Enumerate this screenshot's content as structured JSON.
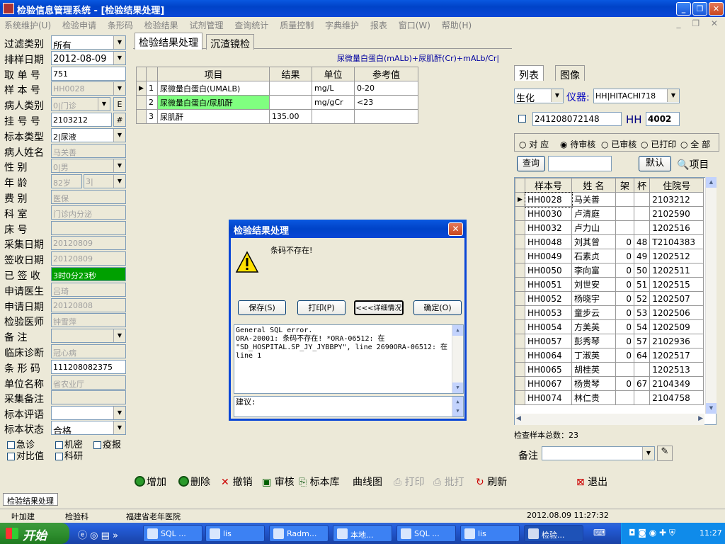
{
  "window": {
    "title": "检验信息管理系统 - [检验结果处理]"
  },
  "menu": [
    "系统维护(U)",
    "检验申请",
    "条形码",
    "检验结果",
    "试剂管理",
    "查询统计",
    "质量控制",
    "字典维护",
    "报表",
    "窗口(W)",
    "帮助(H)"
  ],
  "left": {
    "filter_label": "过滤类别",
    "filter_value": "所有",
    "sort_date_label": "排样日期",
    "sort_date_value": "2012-08-09",
    "order_no_label": "取 单 号",
    "order_no_value": "751",
    "sample_no_label": "样 本 号",
    "sample_no_value": "HH0028",
    "patient_type_label": "病人类别",
    "patient_type_value": "0|门诊",
    "patient_type_btn": "E",
    "reg_no_label": "挂 号 号",
    "reg_no_value": "2103212",
    "reg_no_btn": "#",
    "specimen_label": "标本类型",
    "specimen_value": "2|尿液",
    "name_label": "病人姓名",
    "name_value": "马关善",
    "sex_label": "性    别",
    "sex_value": "0|男",
    "age_label": "年    龄",
    "age_value": "82岁",
    "age_unit": "3|",
    "fee_label": "费    别",
    "fee_value": "医保",
    "dept_label": "科    室",
    "dept_value": "门诊内分泌",
    "bed_label": "床    号",
    "bed_value": "",
    "collect_date_label": "采集日期",
    "collect_date_value": "20120809",
    "receive_date_label": "签收日期",
    "receive_date_value": "20120809",
    "signed_label": "已 签 收",
    "signed_value": "3时0分23秒",
    "req_doctor_label": "申请医生",
    "req_doctor_value": "吕琦",
    "req_date_label": "申请日期",
    "req_date_value": "20120808",
    "lab_doctor_label": "检验医师",
    "lab_doctor_value": "钟雪萍",
    "note_label": "备    注",
    "note_value": "",
    "diag_label": "临床诊断",
    "diag_value": "冠心病",
    "barcode_label": "条 形 码",
    "barcode_value": "111208082375",
    "unit_label": "单位名称",
    "unit_value": "省农业厅",
    "collect_note_label": "采集备注",
    "collect_note_value": "",
    "eval_label": "标本评语",
    "eval_value": "",
    "status_label": "标本状态",
    "status_value": "合格",
    "cb_urgent": "急诊",
    "cb_secret": "机密",
    "cb_epidemic": "疫报",
    "cb_compare": "对比值",
    "cb_research": "科研"
  },
  "tabs": [
    "检验结果处理",
    "沉渣镜检"
  ],
  "formula": "尿微量白蛋白(mALb)+尿肌酐(Cr)+mALb/Cr|",
  "results": {
    "headers": [
      "项目",
      "结果",
      "单位",
      "参考值"
    ],
    "rows": [
      {
        "no": "1",
        "item": "尿微量白蛋白(UMALB)",
        "result": "",
        "unit": "mg/L",
        "ref": "0-20"
      },
      {
        "no": "2",
        "item": "尿微量白蛋白/尿肌酐",
        "result": "",
        "unit": "mg/gCr",
        "ref": "<23"
      },
      {
        "no": "3",
        "item": "尿肌酐",
        "result": "135.00",
        "unit": "",
        "ref": ""
      }
    ]
  },
  "right": {
    "tabs": [
      "列表",
      "图像"
    ],
    "category": "生化",
    "instrument_label": "仪器:",
    "instrument_value": "HH|HITACHI718",
    "barcode": "241208072148",
    "prefix": "HH",
    "number": "4002",
    "radios": [
      "对 应",
      "待审核",
      "已审核",
      "已打印",
      "全 部"
    ],
    "query_btn": "查询",
    "default_btn": "默认",
    "item_btn": "项目",
    "headers": [
      "样本号",
      "姓 名",
      "架",
      "杯",
      "住院号"
    ],
    "rows": [
      [
        "HH0028",
        "马关善",
        "",
        "",
        "2103212"
      ],
      [
        "HH0030",
        "卢清庭",
        "",
        "",
        "2102590"
      ],
      [
        "HH0032",
        "卢力山",
        "",
        "",
        "1202516"
      ],
      [
        "HH0048",
        "刘其曾",
        "0",
        "48",
        "T2104383"
      ],
      [
        "HH0049",
        "石素贞",
        "0",
        "49",
        "1202512"
      ],
      [
        "HH0050",
        "李向富",
        "0",
        "50",
        "1202511"
      ],
      [
        "HH0051",
        "刘世安",
        "0",
        "51",
        "1202515"
      ],
      [
        "HH0052",
        "杨晓宇",
        "0",
        "52",
        "1202507"
      ],
      [
        "HH0053",
        "童步云",
        "0",
        "53",
        "1202506"
      ],
      [
        "HH0054",
        "方美英",
        "0",
        "54",
        "1202509"
      ],
      [
        "HH0057",
        "彭秀琴",
        "0",
        "57",
        "2102936"
      ],
      [
        "HH0064",
        "丁淑英",
        "0",
        "64",
        "1202517"
      ],
      [
        "HH0065",
        "胡桂英",
        "",
        "",
        "1202513"
      ],
      [
        "HH0067",
        "杨贵琴",
        "0",
        "67",
        "2104349"
      ],
      [
        "HH0074",
        "林仁贵",
        "",
        "",
        "2104758"
      ]
    ],
    "total": "检查样本总数：23",
    "note_label": "备注"
  },
  "dialog": {
    "title": "检验结果处理",
    "message": "条码不存在!",
    "buttons": [
      "保存(S)",
      "打印(P)",
      "<<<详细情况",
      "确定(O)"
    ],
    "detail": "General SQL error.\nORA-20001: 条码不存在! *ORA-06512: 在\n\"SD_HOSPITAL.SP_JY_JYBBPY\", line 2690ORA-06512: 在\nline 1",
    "advice": "建议:"
  },
  "toolbar": [
    "增加",
    "删除",
    "撤销",
    "审核",
    "标本库",
    "曲线图",
    "打印",
    "批打",
    "刷新",
    "退出"
  ],
  "status": {
    "module": "检验结果处理",
    "user": "叶加建",
    "dept": "检验科",
    "hospital": "福建省老年医院",
    "datetime": "2012.08.09 11:27:32"
  },
  "taskbar": {
    "start": "开始",
    "tasks": [
      "SQL ...",
      "lis",
      "Radm...",
      "本地...",
      "SQL ...",
      "lis",
      "检验..."
    ],
    "time": "11:27"
  }
}
